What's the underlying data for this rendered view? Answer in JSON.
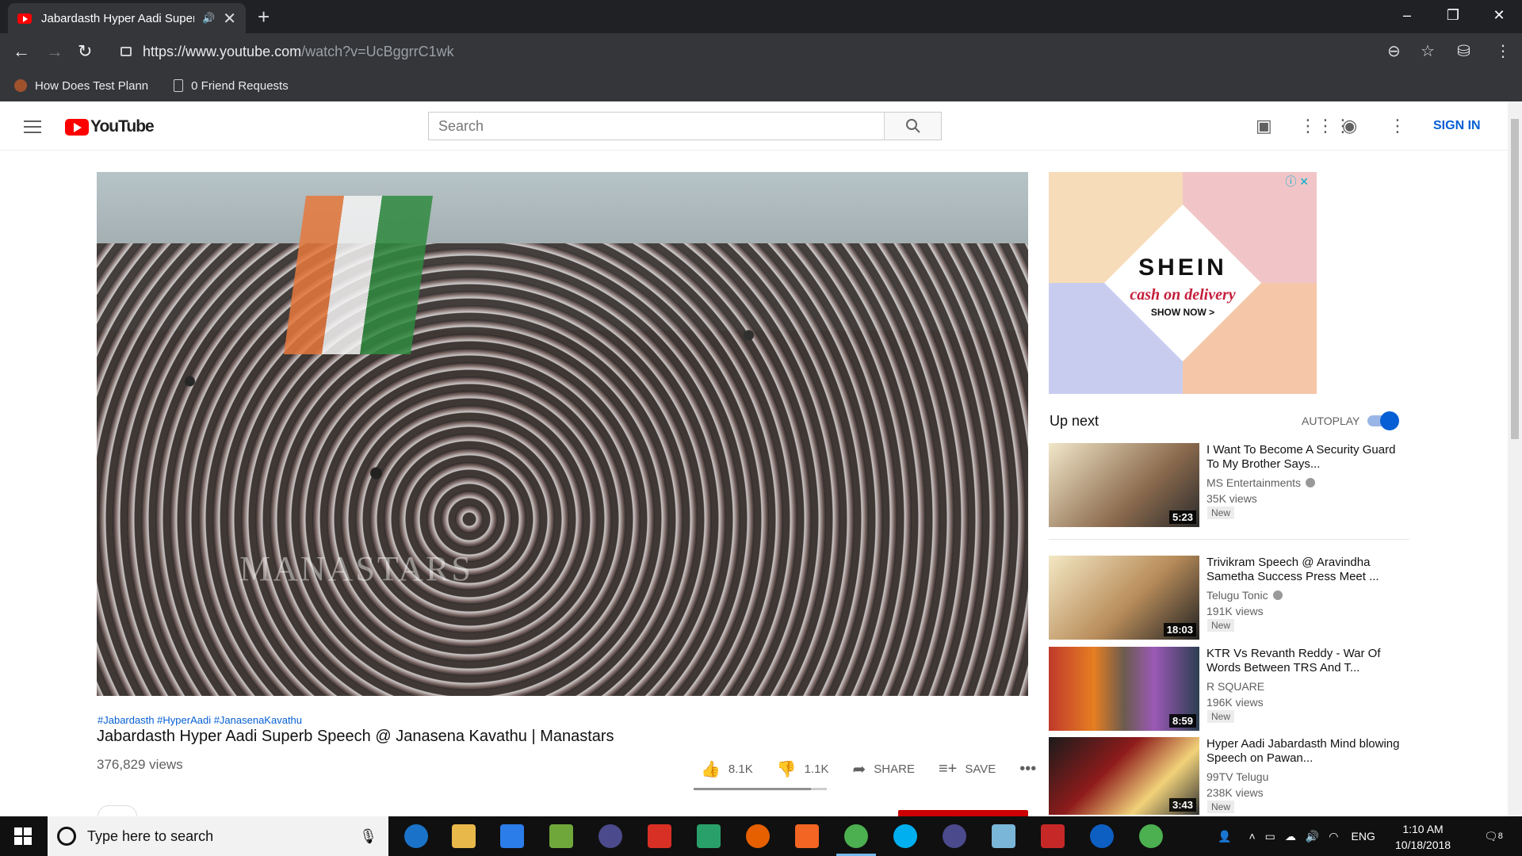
{
  "browser": {
    "tab_title": "Jabardasth Hyper Aadi Superb",
    "url_host": "https://www.youtube.com",
    "url_path": "/watch?v=UcBggrrC1wk",
    "bookmarks": [
      "How Does Test Plann",
      "0 Friend Requests"
    ]
  },
  "youtube": {
    "logo_text": "YouTube",
    "search_placeholder": "Search",
    "sign_in": "SIGN IN"
  },
  "video": {
    "watermark": "MANASTARS",
    "hashtags": "#Jabardasth #HyperAadi #JanasenaKavathu",
    "title": "Jabardasth Hyper Aadi Superb Speech @ Janasena Kavathu | Manastars",
    "views": "376,829 views",
    "likes": "8.1K",
    "dislikes": "1.1K",
    "share": "SHARE",
    "save": "SAVE",
    "like_ratio": 0.88
  },
  "ad": {
    "brand": "SHEIN",
    "tagline": "cash on delivery",
    "cta": "SHOW NOW >",
    "colors": [
      "#f6dcb9",
      "#f1c5c7",
      "#c8cdf0",
      "#f5c6a8"
    ]
  },
  "sidebar": {
    "up_next": "Up next",
    "autoplay": "AUTOPLAY",
    "autoplay_on": true,
    "recommendations": [
      {
        "title": "I Want To Become A Security Guard To My Brother Says...",
        "channel": "MS Entertainments",
        "verified": true,
        "views": "35K views",
        "badge": "New",
        "duration": "5:23"
      },
      {
        "title": "Trivikram Speech @ Aravindha Sametha Success Press Meet ...",
        "channel": "Telugu Tonic",
        "verified": true,
        "views": "191K views",
        "badge": "New",
        "duration": "18:03"
      },
      {
        "title": "KTR Vs Revanth Reddy - War Of Words Between TRS And T...",
        "channel": "R SQUARE",
        "verified": false,
        "views": "196K views",
        "badge": "New",
        "duration": "8:59"
      },
      {
        "title": "Hyper Aadi Jabardasth Mind blowing Speech on Pawan...",
        "channel": "99TV Telugu",
        "verified": false,
        "views": "238K views",
        "badge": "New",
        "duration": "3:43"
      }
    ]
  },
  "taskbar": {
    "search_placeholder": "Type here to search",
    "language": "ENG",
    "time": "1:10 AM",
    "date": "10/18/2018",
    "notifications": "8"
  }
}
